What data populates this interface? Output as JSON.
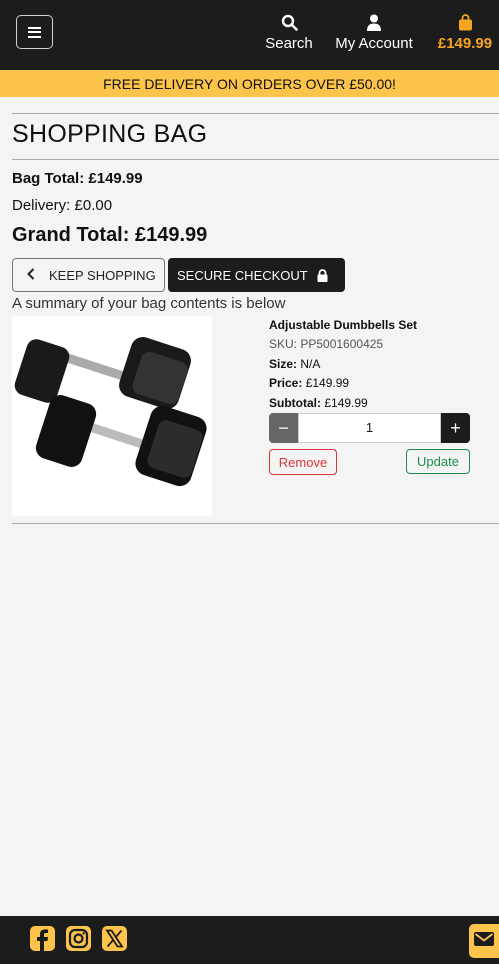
{
  "header": {
    "search_label": "Search",
    "account_label": "My Account",
    "bag_total": "£149.99"
  },
  "promo": {
    "text": "FREE DELIVERY ON ORDERS OVER £50.00!"
  },
  "cart": {
    "title": "SHOPPING BAG",
    "bag_total": "Bag Total: £149.99",
    "delivery": "Delivery: £0.00",
    "grand_total": "Grand Total: £149.99",
    "keep_shopping": "KEEP SHOPPING",
    "secure_checkout": "SECURE CHECKOUT",
    "summary": "A summary of your bag contents is below"
  },
  "item": {
    "name": "Adjustable Dumbbells Set",
    "sku": "SKU: PP5001600425",
    "size_label": "Size:",
    "size_value": "N/A",
    "price_label": "Price:",
    "price_value": "£149.99",
    "subtotal_label": "Subtotal:",
    "subtotal_value": "£149.99",
    "quantity": "1",
    "remove_label": "Remove",
    "update_label": "Update",
    "minus": "−",
    "plus": "+"
  },
  "colors": {
    "header_bg": "#1c1c1c",
    "accent": "#fcc44b",
    "bag_price": "#f5a623",
    "remove": "#d9363e",
    "update": "#1e8a4c"
  },
  "icons": {
    "menu": "hamburger-icon",
    "search": "search-icon",
    "account": "user-icon",
    "bag": "shopping-bag-icon",
    "keep": "chevron-left-icon",
    "checkout": "lock-icon",
    "social": [
      "facebook-icon",
      "instagram-icon",
      "x-icon"
    ],
    "mail": "mail-icon"
  }
}
